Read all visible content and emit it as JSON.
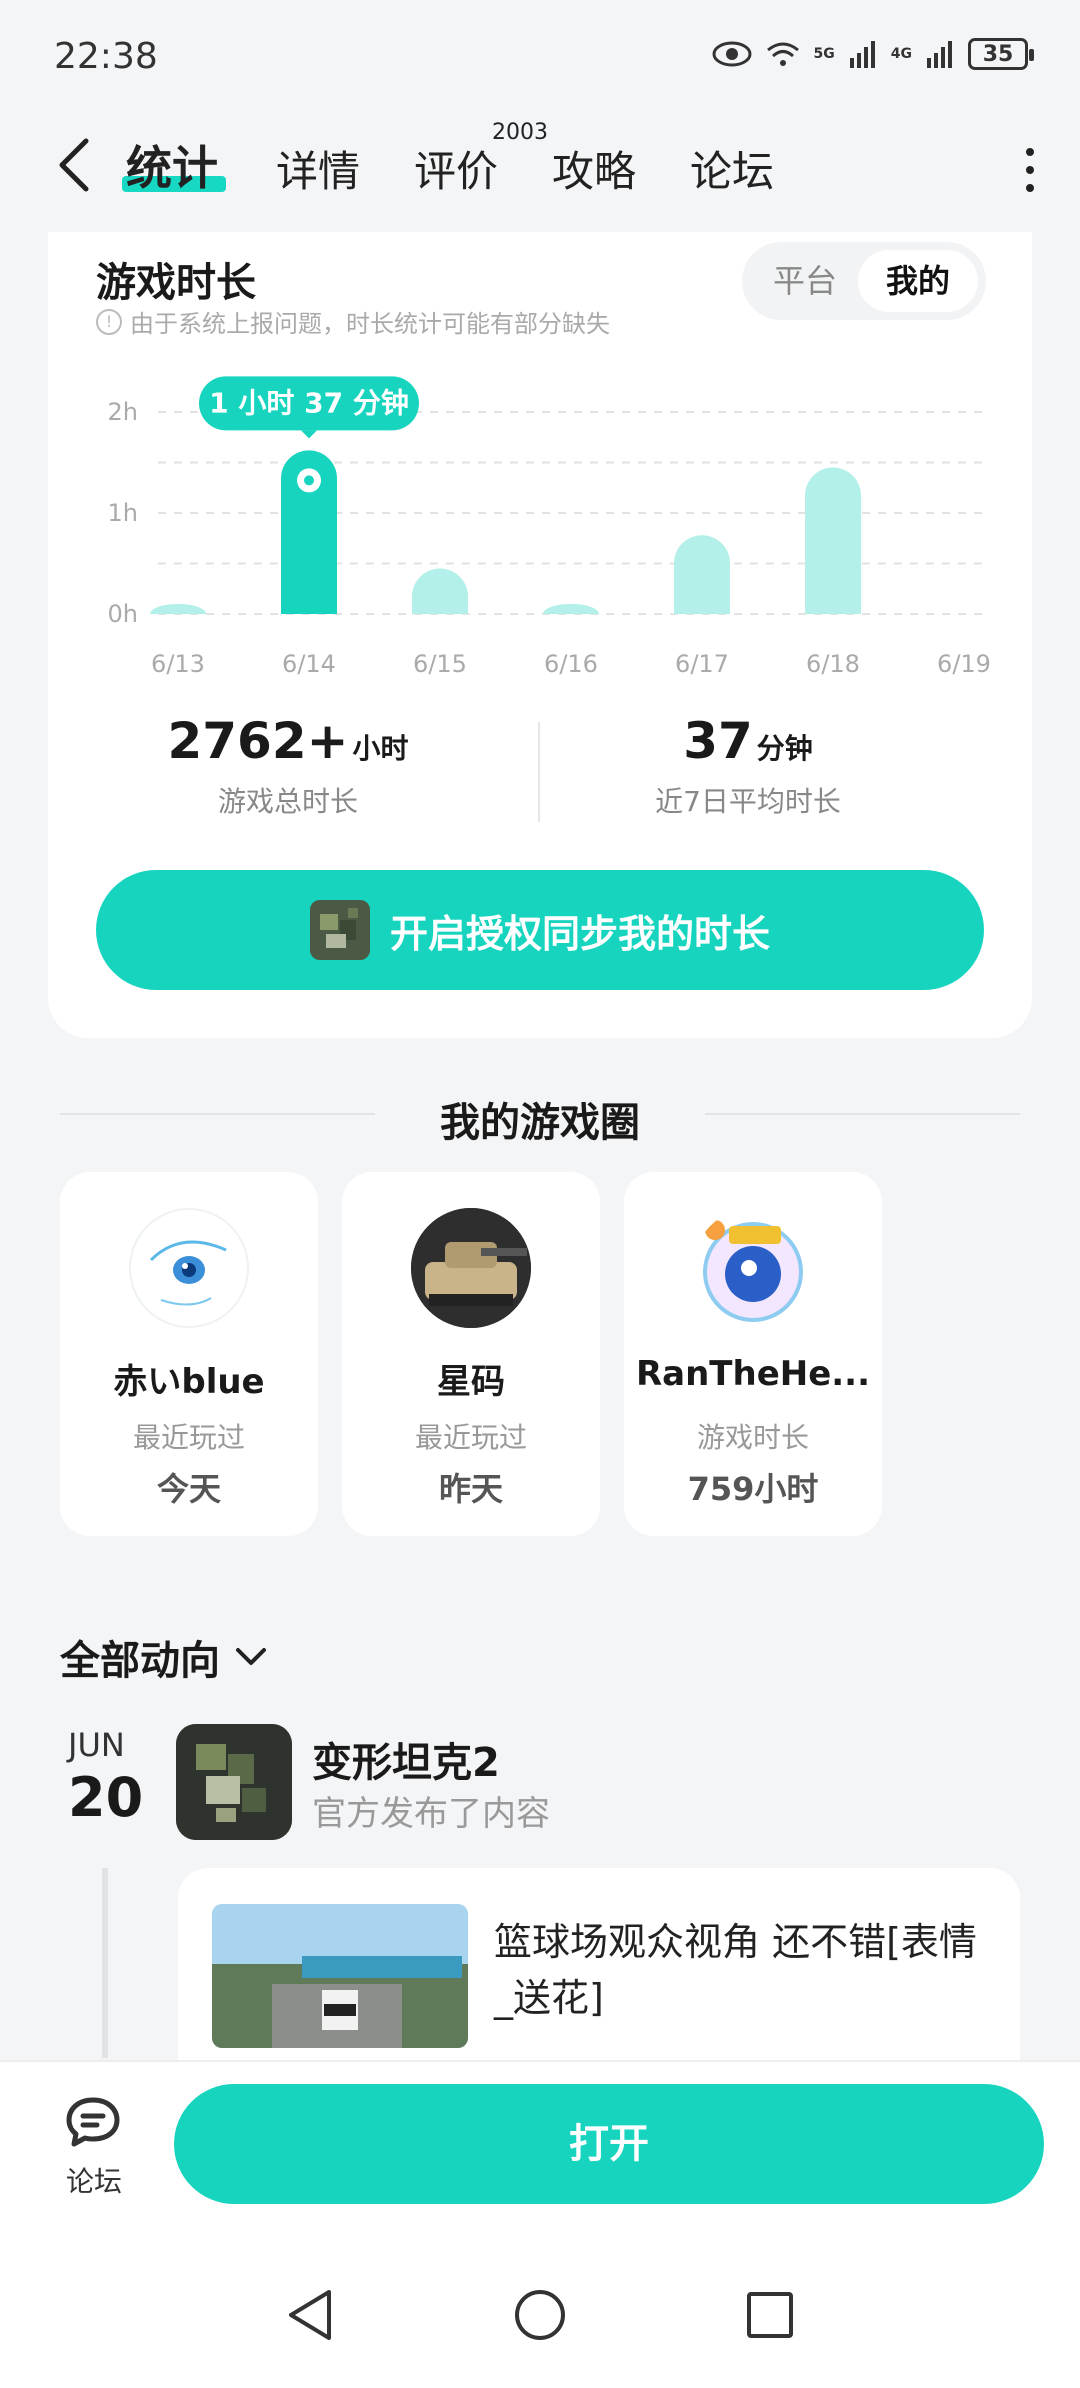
{
  "status_bar": {
    "time": "22:38",
    "battery": "35",
    "net1": "5G",
    "net2": "4G"
  },
  "nav": {
    "tabs": [
      {
        "label": "统计"
      },
      {
        "label": "详情"
      },
      {
        "label": "评价"
      },
      {
        "label": "攻略"
      },
      {
        "label": "论坛"
      }
    ],
    "review_count": "2003"
  },
  "stats": {
    "title": "游戏时长",
    "notice": "由于系统上报问题，时长统计可能有部分缺失",
    "toggle": {
      "platform": "平台",
      "mine": "我的"
    },
    "tooltip": "1 小时 37 分钟",
    "total_value": "2762+",
    "total_unit": "小时",
    "total_label": "游戏总时长",
    "avg_value": "37",
    "avg_unit": "分钟",
    "avg_label": "近7日平均时长",
    "sync_button": "开启授权同步我的时长"
  },
  "chart_data": {
    "type": "bar",
    "categories": [
      "6/13",
      "6/14",
      "6/15",
      "6/16",
      "6/17",
      "6/18",
      "6/19"
    ],
    "values": [
      0.1,
      1.62,
      0.45,
      0.1,
      0.78,
      1.45,
      0
    ],
    "y_ticks": [
      "0h",
      "1h",
      "2h"
    ],
    "ylim": [
      0,
      2
    ],
    "highlight_index": 1,
    "colors": {
      "highlight": "#17d4bf",
      "normal": "#b3f0e9"
    }
  },
  "circle": {
    "title": "我的游戏圈",
    "friends": [
      {
        "name": "赤いblue",
        "meta": "最近玩过",
        "value": "今天"
      },
      {
        "name": "星码",
        "meta": "最近玩过",
        "value": "昨天"
      },
      {
        "name": "RanTheHe...",
        "meta": "游戏时长",
        "value": "759小时"
      }
    ]
  },
  "feed": {
    "header": "全部动向",
    "month": "JUN",
    "day": "20",
    "game_name": "变形坦克2",
    "game_sub": "官方发布了内容",
    "post_text": "篮球场观众视角 还不错[表情_送花]"
  },
  "bottom": {
    "forum_label": "论坛",
    "open_button": "打开"
  },
  "colors": {
    "accent": "#17d4bf",
    "accent_light": "#b3f0e9"
  }
}
